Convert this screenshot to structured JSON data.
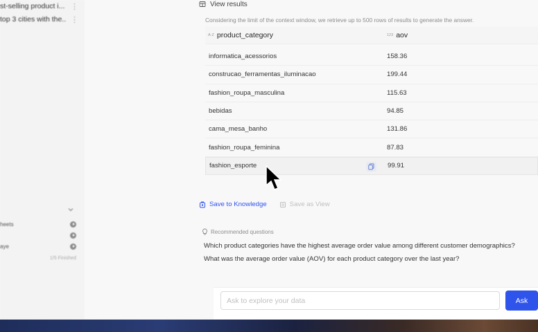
{
  "sidebar": {
    "threads": [
      {
        "label": "st-selling product i..."
      },
      {
        "label": "top 3 cities with the..."
      }
    ],
    "sections": [
      {
        "label": "heets"
      },
      {
        "label": ""
      },
      {
        "label": "aye"
      }
    ],
    "status": "1/5 Finished"
  },
  "results": {
    "header": "View results",
    "note": "Considering the limit of the context window, we retrieve up to 500 rows of results to generate the answer.",
    "columns": [
      {
        "label": "product_category",
        "type_icon": "A-Z"
      },
      {
        "label": "aov",
        "type_icon": "123"
      }
    ],
    "rows": [
      {
        "category": "informatica_acessorios",
        "aov": "158.36"
      },
      {
        "category": "construcao_ferramentas_iluminacao",
        "aov": "199.44"
      },
      {
        "category": "fashion_roupa_masculina",
        "aov": "115.63"
      },
      {
        "category": "bebidas",
        "aov": "94.85"
      },
      {
        "category": "cama_mesa_banho",
        "aov": "131.86"
      },
      {
        "category": "fashion_roupa_feminina",
        "aov": "87.83"
      },
      {
        "category": "fashion_esporte",
        "aov": "99.91"
      }
    ]
  },
  "actions": {
    "save_knowledge": "Save to Knowledge",
    "save_view": "Save as View"
  },
  "recommended": {
    "title": "Recommended questions",
    "questions": [
      "Which product categories have the highest average order value among different customer demographics?",
      "What was the average order value (AOV) for each product category over the last year?"
    ]
  },
  "ask": {
    "placeholder": "Ask to explore your data",
    "button": "Ask"
  },
  "colors": {
    "accent": "#2f54eb",
    "muted": "#8c8c8c"
  }
}
